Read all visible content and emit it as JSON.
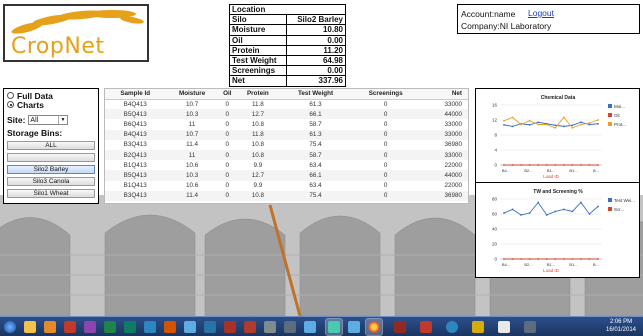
{
  "logo": {
    "text_part1": "Crop",
    "text_part2": "Net"
  },
  "location": {
    "header": "Location",
    "rows": [
      {
        "label": "Silo",
        "value": "Silo2 Barley"
      },
      {
        "label": "Moisture",
        "value": "10.80"
      },
      {
        "label": "Oil",
        "value": "0.00"
      },
      {
        "label": "Protein",
        "value": "11.20"
      },
      {
        "label": "Test Weight",
        "value": "64.98"
      },
      {
        "label": "Screenings",
        "value": "0.00"
      },
      {
        "label": "Net",
        "value": "337.96"
      }
    ]
  },
  "account": {
    "name_line": "Account:name",
    "logout": "Logout",
    "company_line": "Company:NI Laboratory"
  },
  "view_options": {
    "full_data": "Full Data",
    "charts": "Charts",
    "selected": "charts"
  },
  "site": {
    "label": "Site:",
    "value": "All"
  },
  "storage_bins": {
    "title": "Storage Bins:",
    "items": [
      "ALL",
      "",
      "Silo2 Barley",
      "Silo3 Canola",
      "Silo1 Wheat"
    ],
    "selected_index": 2
  },
  "grid": {
    "columns": [
      "Sample Id",
      "Moisture",
      "Oil",
      "Protein",
      "Test Weight",
      "Screenings",
      "Net"
    ],
    "rows": [
      [
        "B4Q413",
        "10.7",
        "0",
        "11.8",
        "61.3",
        "0",
        "33000"
      ],
      [
        "B5Q413",
        "10.3",
        "0",
        "12.7",
        "66.1",
        "0",
        "44000"
      ],
      [
        "B6Q413",
        "11",
        "0",
        "10.8",
        "58.7",
        "0",
        "33000"
      ],
      [
        "B4Q413",
        "10.7",
        "0",
        "11.8",
        "61.3",
        "0",
        "33000"
      ],
      [
        "B3Q413",
        "11.4",
        "0",
        "10.8",
        "75.4",
        "0",
        "36980"
      ],
      [
        "B2Q413",
        "11",
        "0",
        "10.8",
        "58.7",
        "0",
        "33000"
      ],
      [
        "B1Q413",
        "10.6",
        "0",
        "9.9",
        "63.4",
        "0",
        "22000"
      ],
      [
        "B5Q413",
        "10.3",
        "0",
        "12.7",
        "66.1",
        "0",
        "44000"
      ],
      [
        "B1Q413",
        "10.6",
        "0",
        "9.9",
        "63.4",
        "0",
        "22000"
      ],
      [
        "B3Q413",
        "11.4",
        "0",
        "10.8",
        "75.4",
        "0",
        "36980"
      ]
    ]
  },
  "chart_data": [
    {
      "type": "line",
      "title": "Chemical Data",
      "xlabel": "Load ID",
      "categories": [
        "B4...",
        "B2...",
        "B1...",
        "B1...",
        "B..."
      ],
      "ylim": [
        0,
        16
      ],
      "yticks": [
        "16",
        "12",
        "8",
        "4",
        "0"
      ],
      "series": [
        {
          "name": "Moi...",
          "color": "#3a6fc4",
          "values": [
            10.7,
            10.3,
            11,
            10.7,
            11.4,
            11,
            10.6,
            10.3,
            10.6,
            11.4,
            10.8,
            11
          ]
        },
        {
          "name": "Oil",
          "color": "#d6442e",
          "values": [
            0,
            0,
            0,
            0,
            0,
            0,
            0,
            0,
            0,
            0,
            0,
            0
          ]
        },
        {
          "name": "Prot...",
          "color": "#e8a020",
          "values": [
            11.8,
            12.7,
            10.8,
            11.8,
            10.8,
            10.8,
            9.9,
            12.7,
            9.9,
            10.8,
            11.2,
            12
          ]
        }
      ]
    },
    {
      "type": "line",
      "title": "TW and Screening %",
      "xlabel": "Load ID",
      "categories": [
        "B4...",
        "B2...",
        "B1...",
        "B1...",
        "B..."
      ],
      "ylim": [
        0,
        80
      ],
      "yticks": [
        "80",
        "60",
        "40",
        "20",
        "0"
      ],
      "series": [
        {
          "name": "Test Wei...",
          "color": "#3a6fc4",
          "values": [
            61.3,
            66.1,
            58.7,
            61.3,
            75.4,
            58.7,
            63.4,
            66.1,
            63.4,
            75.4,
            60,
            70
          ]
        },
        {
          "name": "Scr...",
          "color": "#d6442e",
          "values": [
            0,
            0,
            0,
            0,
            0,
            0,
            0,
            0,
            0,
            0,
            0,
            0
          ]
        }
      ]
    }
  ],
  "taskbar": {
    "time": "2:06 PM",
    "date": "16/01/2014"
  },
  "colors": {
    "accent": "#e6a11a",
    "link": "#1a3fb0"
  }
}
